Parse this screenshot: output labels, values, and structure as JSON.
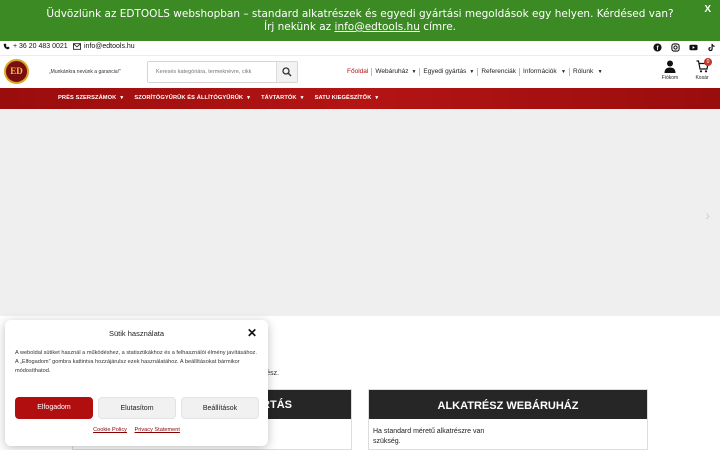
{
  "colors": {
    "notice_bg": "#3c8a24",
    "brand_red": "#b10f0f",
    "dark_header": "#262626",
    "active_nav": "#b31313"
  },
  "notice": {
    "text": "Üdvözlünk az EDTOOLS webshopban – standard alkatrészek és egyedi gyártási megoldások egy helyen. Kérdésed van? Írj nekünk az",
    "email": "info@edtools.hu",
    "suffix": "címre.",
    "close": "X"
  },
  "contact": {
    "phone": "+ 36 20 483 0021",
    "email": "info@edtools.hu",
    "social_icons": [
      "facebook-icon",
      "instagram-icon",
      "youtube-icon",
      "tiktok-icon"
    ]
  },
  "header": {
    "logo": "ED",
    "slogan": "„Munkánkra nevünk a garancia!”",
    "search_placeholder": "Keresés kategóriára, termeknévre, cikk",
    "nav": [
      {
        "label": "Főoldal",
        "caret": false
      },
      {
        "label": "Webáruház",
        "caret": true
      },
      {
        "label": "Egyedi gyártás",
        "caret": true
      },
      {
        "label": "Referenciák",
        "caret": false
      },
      {
        "label": "Információk",
        "caret": true
      },
      {
        "label": "Rólunk",
        "caret": true
      }
    ],
    "account_label": "Fiókom",
    "cart_label": "Kosár",
    "cart_count": "0"
  },
  "categories": [
    "PRÉS SZERSZÁMOK",
    "SZORÍTÓGYŰRŰK ÉS ÁLLÍTÓGYŰRŰK",
    "TÁVTARTÓK",
    "SATU KIEGÉSZÍTŐK"
  ],
  "content": {
    "partial_text": "trész.",
    "left_heading": "RTÁS",
    "right_heading": "ALKATRÉSZ WEBÁRUHÁZ",
    "right_body": "Ha standard méretű alkatrészre van szükség."
  },
  "cookie": {
    "title": "Sütik használata",
    "description": "A weboldal sütiket használ a működéshez, a statisztikákhoz és a felhasználói élmény javításához. A „Elfogadom\" gombra kattintva hozzájárulsz ezek használatához. A beállításokat bármikor módosíthatod.",
    "accept": "Elfogadom",
    "deny": "Elutasítom",
    "settings": "Beállítások",
    "cookie_policy": "Cookie Policy",
    "privacy": "Privacy Statement",
    "close": "✕"
  }
}
